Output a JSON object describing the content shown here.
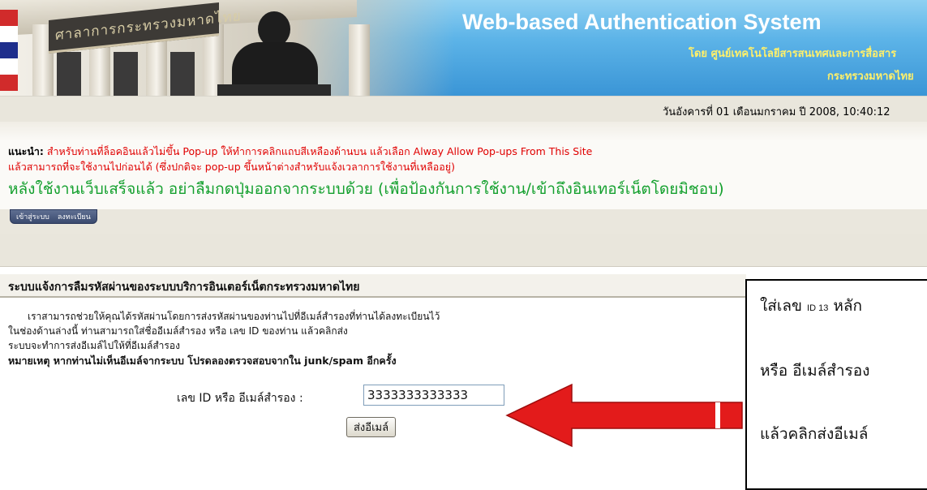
{
  "banner": {
    "sign_text": "ศาลาการกระทรวงมหาดไทย",
    "title": "Web-based Authentication System",
    "subtitle_line1": "โดย ศูนย์เทคโนโลยีสารสนเทศและการสื่อสาร",
    "subtitle_line2": "กระทรวงมหาดไทย"
  },
  "datebar": {
    "date_text": "วันอังคารที่ 01 เดือนมกราคม ปี 2008, 10:40:12"
  },
  "advice": {
    "label": "แนะนำ:",
    "line1": " สำหรับท่านที่ล็อคอินแล้วไม่ขึ้น Pop-up ให้ทำการคลิกแถบสีเหลืองด้านบน แล้วเลือก Alway Allow Pop-ups From This Site",
    "line2": "แล้วสามารถที่จะใช้งานไปก่อนได้ (ซึ่งปกติจะ pop-up ขึ้นหน้าต่างสำหรับแจ้งเวลาการใช้งานที่เหลืออยู่)",
    "line3": "หลังใช้งานเว็บเสร็จแล้ว อย่าลืมกดปุ่มออกจากระบบด้วย (เพื่อป้องกันการใช้งาน/เข้าถึงอินเทอร์เน็ตโดยมิชอบ)"
  },
  "tabs": {
    "login": "เข้าสู่ระบบ",
    "register": "ลงทะเบียน"
  },
  "section": {
    "header": "ระบบแจ้งการลืมรหัสผ่านของระบบบริการอินเตอร์เน็ตกระทรวงมหาดไทย",
    "para1": "เราสามารถช่วยให้คุณได้รหัสผ่านโดยการส่งรหัสผ่านของท่านไปที่อีเมล์สำรองที่ท่านได้ลงทะเบียนไว้",
    "para2": "ในช่องด้านล่างนี้ ท่านสามารถใส่ชื่ออีเมล์สำรอง หรือ เลข ID ของท่าน แล้วคลิกส่ง",
    "para3": "ระบบจะทำการส่งอีเมล์ไปให้ที่อีเมล์สำรอง",
    "note": "หมายเหตุ หากท่านไม่เห็นอีเมล์จากระบบ โปรดลองตรวจสอบจากใน junk/spam อีกครั้ง",
    "field_label": "เลข ID หรือ อีเมล์สำรอง :",
    "field_value": "3333333333333",
    "send_button": "ส่งอีเมล์"
  },
  "callout": {
    "line1_a": "ใส่เลข ",
    "line1_small": "ID 13",
    "line1_b": " หลัก",
    "line2": "หรือ อีเมล์สำรอง",
    "line3": "แล้วคลิกส่งอีเมล์"
  },
  "colors": {
    "banner_title": "#ffffff",
    "banner_subtitle": "#fff06a",
    "advice_red": "#e00000",
    "advice_green": "#14a02e",
    "arrow_red": "#e31b1b"
  }
}
